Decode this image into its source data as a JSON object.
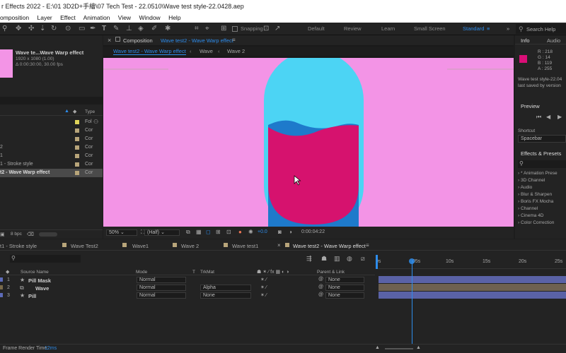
{
  "titlebar": {
    "text": "r Effects 2022 - E:\\01 3D2D+手繪\\07 Tech Test - 22.0510\\Wave test style-22.0428.aep"
  },
  "menu": [
    "omposition",
    "Layer",
    "Effect",
    "Animation",
    "View",
    "Window",
    "Help"
  ],
  "toolbar": {
    "snapping": "Snapping",
    "workspaces": [
      "Default",
      "Review",
      "Learn",
      "Small Screen",
      "Standard"
    ],
    "search": "Search Help"
  },
  "project": {
    "item_name": "Wave te...Wave Warp effect",
    "item_dims": "1920 x 1080 (1.00)",
    "item_dur": "Δ 0:00:30:00, 30.00 fps",
    "type_header": "Type",
    "rows": [
      {
        "name": "",
        "type": "Fol"
      },
      {
        "name": "",
        "type": "Cor"
      },
      {
        "name": "",
        "type": "Cor"
      },
      {
        "name": "2",
        "type": "Cor"
      },
      {
        "name": "1",
        "type": "Cor"
      },
      {
        "name": "1 - Stroke style",
        "type": "Cor"
      },
      {
        "name": "t2 - Wave Warp effect",
        "type": "Cor"
      }
    ],
    "bpc": "8 bpc"
  },
  "comp": {
    "panel_label": "Composition",
    "panel_name": "Wave test2 - Wave Warp effect",
    "breadcrumbs": [
      "Wave test2 - Wave Warp effect",
      "Wave",
      "Wave 2"
    ],
    "zoom": "50%",
    "resolution": "(Half)",
    "exposure": "+0.0",
    "timecode": "0:00:04:22",
    "colors": {
      "bg": "#f394e6",
      "pill": "#4cd4f4",
      "wave_back": "#1e7acb",
      "wave_front": "#d6126e"
    }
  },
  "info": {
    "tab_info": "Info",
    "tab_audio": "Audio",
    "r": "R : 218",
    "g": "G : 14",
    "b": "B : 119",
    "a": "A : 255",
    "swatch": "#da0e77",
    "file": "Wave test style-22.04",
    "saved": "last saved by version",
    "preview": "Preview",
    "shortcut": "Shortcut",
    "shortcut_value": "Spacebar",
    "effects": "Effects & Presets",
    "effects_items": [
      "* Animation Prese",
      "3D Channel",
      "Audio",
      "Blur & Sharpen",
      "Boris FX Mocha",
      "Channel",
      "Cinema 4D",
      "Color Correction"
    ]
  },
  "timeline": {
    "tabs": [
      "t1 - Stroke style",
      "Wave Test2",
      "Wave1",
      "Wave 2",
      "Wave test1",
      "Wave test2 - Wave Warp effect"
    ],
    "headers": {
      "source": "Source Name",
      "mode": "Mode",
      "t": "T",
      "trkmat": "TrkMat",
      "parent": "Parent & Link"
    },
    "layers": [
      {
        "num": "1",
        "name": "Pill Mask",
        "mode": "Normal",
        "trkmat": "",
        "parent": "None",
        "color": "#5d6bb8"
      },
      {
        "num": "2",
        "name": "Wave",
        "mode": "Normal",
        "trkmat": "Alpha",
        "parent": "None",
        "color": "#7a6a4a"
      },
      {
        "num": "3",
        "name": "Pill",
        "mode": "Normal",
        "trkmat": "None",
        "parent": "None",
        "color": "#5d6bb8"
      }
    ],
    "ruler": [
      "0s",
      "05s",
      "10s",
      "15s",
      "20s",
      "25s"
    ],
    "render_label": "Frame Render Time:",
    "render_value": "12ms"
  }
}
